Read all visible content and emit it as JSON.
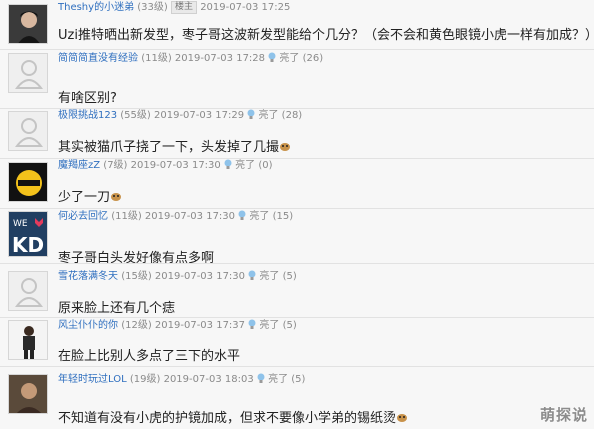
{
  "posts": [
    {
      "username": "Theshy的小迷弟",
      "level": "(33级)",
      "badge": "楼主",
      "timestamp": "2019-07-03 17:25",
      "likes": "",
      "content": "Uzi推特晒出新发型，枣子哥这波新发型能给个几分？（会不会和黄色眼镜小虎一样有加成？）",
      "avatar": "photo-avatar"
    },
    {
      "username": "简简简直没有经验",
      "level": "(11级)",
      "badge": "",
      "timestamp": "2019-07-03 17:28",
      "likes": "亮了 (26)",
      "content": "有啥区别?",
      "avatar": "default-avatar"
    },
    {
      "username": "极限挑战123",
      "level": "(55级)",
      "badge": "",
      "timestamp": "2019-07-03 17:29",
      "likes": "亮了 (28)",
      "content": "其实被猫爪子挠了一下，头发掉了几撮",
      "avatar": "default-avatar"
    },
    {
      "username": "魔羯座zZ",
      "level": "(7级)",
      "badge": "",
      "timestamp": "2019-07-03 17:30",
      "likes": "亮了 (0)",
      "content": "少了一刀",
      "avatar": "lamang-avatar"
    },
    {
      "username": "何必去回忆",
      "level": "(11级)",
      "badge": "",
      "timestamp": "2019-07-03 17:30",
      "likes": "亮了 (15)",
      "content": "枣子哥白头发好像有点多啊",
      "avatar": "kd-avatar"
    },
    {
      "username": "雪花落满冬天",
      "level": "(15级)",
      "badge": "",
      "timestamp": "2019-07-03 17:30",
      "likes": "亮了 (5)",
      "content": "原来脸上还有几个痣",
      "avatar": "default-avatar"
    },
    {
      "username": "风尘仆仆的你",
      "level": "(12级)",
      "badge": "",
      "timestamp": "2019-07-03 17:37",
      "likes": "亮了 (5)",
      "content": "在脸上比别人多点了三下的水平",
      "avatar": "figure-avatar"
    },
    {
      "username": "年轻时玩过LOL",
      "level": "(19级)",
      "badge": "",
      "timestamp": "2019-07-03 18:03",
      "likes": "亮了 (5)",
      "content": "不知道有没有小虎的护镜加成，但求不要像小学弟的锡纸烫",
      "avatar": "photo-avatar-2"
    }
  ],
  "watermark": "萌探说"
}
